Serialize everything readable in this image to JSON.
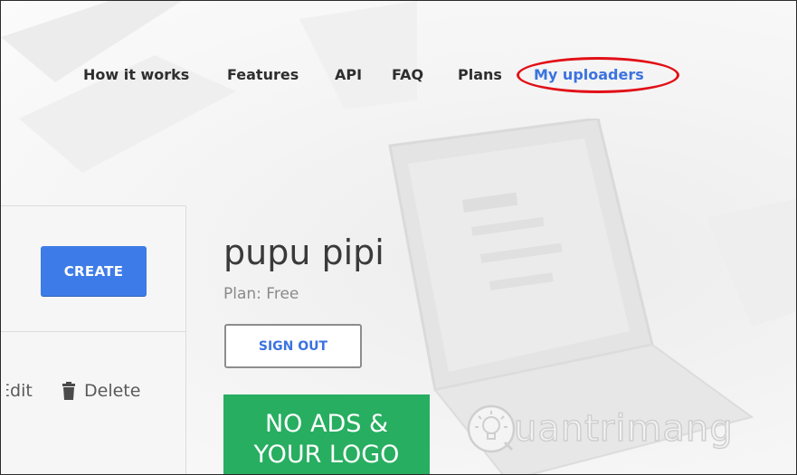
{
  "nav": {
    "items": [
      {
        "label": "How it works"
      },
      {
        "label": "Features"
      },
      {
        "label": "API"
      },
      {
        "label": "FAQ"
      },
      {
        "label": "Plans"
      },
      {
        "label": "My uploaders"
      }
    ],
    "active_index": 5
  },
  "left_panel": {
    "create_label": "CREATE",
    "edit_label": "Edit",
    "delete_label": "Delete"
  },
  "user": {
    "name": "pupu pipi",
    "plan": "Plan: Free",
    "signout_label": "SIGN OUT"
  },
  "promo": {
    "line1": "NO ADS &",
    "line2": "YOUR LOGO"
  },
  "watermark": {
    "text": "uantrimang"
  },
  "colors": {
    "accent": "#3b73e0",
    "button_blue": "#3d7ce8",
    "promo_green": "#27ae60",
    "highlight_red": "#e20f16"
  },
  "icons": [
    "trash-icon",
    "lightbulb-logo-icon"
  ]
}
